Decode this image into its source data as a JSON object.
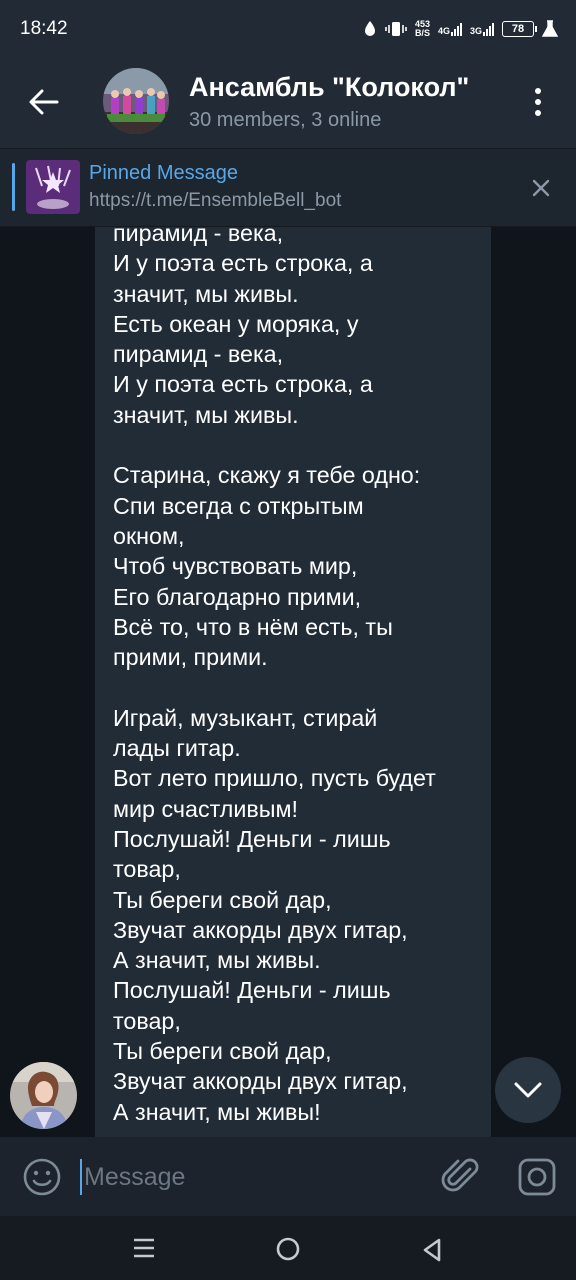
{
  "status_bar": {
    "time": "18:42",
    "net_speed_value": "453",
    "net_speed_unit": "B/S",
    "network_1": "4G",
    "network_2": "3G",
    "battery": "78"
  },
  "header": {
    "title": "Ансамбль \"Колокол\"",
    "subtitle": "30 members, 3 online"
  },
  "pinned": {
    "title": "Pinned Message",
    "text": "https://t.me/EnsembleBell_bot"
  },
  "message": {
    "text": "пирамид - века,\nИ у поэта есть строка, а\nзначит, мы живы.\nЕсть океан у моряка, у\nпирамид - века,\nИ у поэта есть строка, а\nзначит, мы живы.\n\nСтарина, скажу я тебе одно:\nСпи всегда с открытым\nокном,\nЧтоб чувствовать мир,\nЕго благодарно прими,\nВсё то, что в нём есть, ты\nприми, прими.\n\nИграй, музыкант, стирай\nлады гитар.\nВот лето пришло, пусть будет\nмир счастливым!\nПослушай! Деньги - лишь\nтовар,\nТы береги свой дар,\nЗвучат аккорды двух гитар,\nА значит, мы живы.\nПослушай! Деньги - лишь\nтовар,\nТы береги свой дар,\nЗвучат аккорды двух гитар,\nА значит, мы живы!"
  },
  "input": {
    "placeholder": "Message"
  },
  "colors": {
    "accent": "#5aa7e8",
    "header_bg": "#222b35",
    "chat_bg": "#10151b",
    "bubble_bg": "#222c37"
  },
  "icons": {
    "back": "arrow-left-icon",
    "menu": "more-vertical-icon",
    "close": "close-icon",
    "scroll": "chevron-down-icon",
    "emoji": "emoji-icon",
    "attach": "paperclip-icon",
    "camera": "camera-icon"
  }
}
